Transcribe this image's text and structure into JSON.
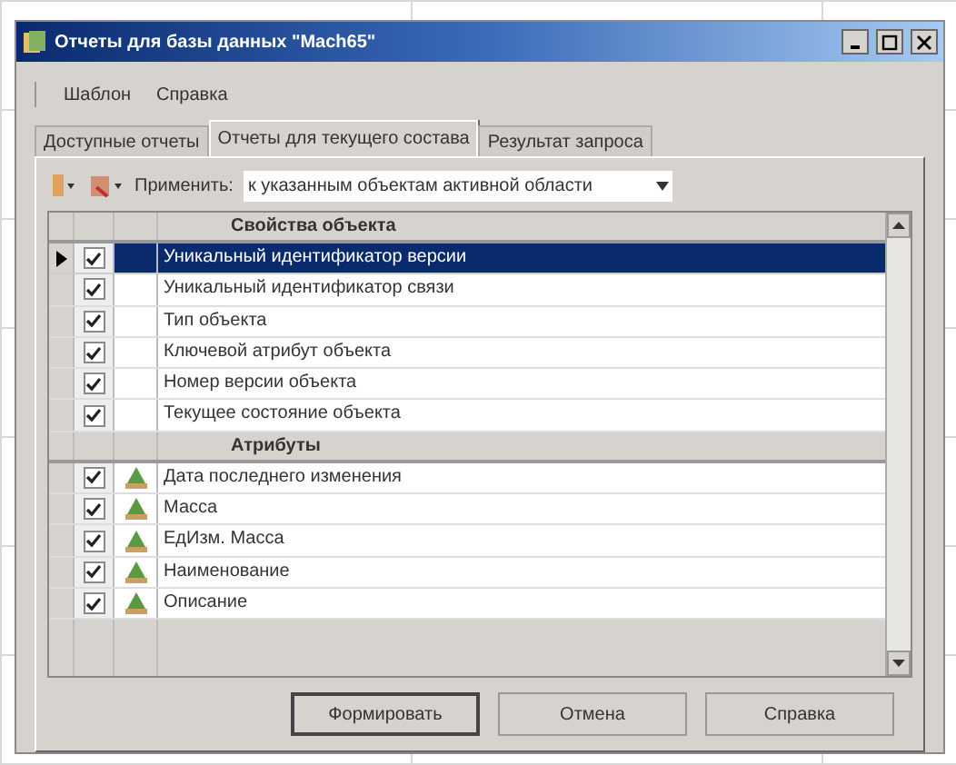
{
  "window": {
    "title": "Отчеты для базы данных \"Mach65\""
  },
  "menu": [
    "Шаблон",
    "Справка"
  ],
  "tabs": [
    {
      "label": "Доступные отчеты",
      "selected": false
    },
    {
      "label": "Отчеты для текущего состава",
      "selected": true
    },
    {
      "label": "Результат запроса",
      "selected": false
    }
  ],
  "toolbar": {
    "apply_label": "Применить:",
    "apply_value": "к указанным объектам активной области"
  },
  "groups": [
    {
      "title": "Свойства объекта",
      "rows": [
        {
          "label": "Уникальный идентификатор версии",
          "checked": true,
          "selected": true,
          "kind": "property"
        },
        {
          "label": "Уникальный идентификатор связи",
          "checked": true,
          "selected": false,
          "kind": "property"
        },
        {
          "label": "Тип объекта",
          "checked": true,
          "selected": false,
          "kind": "property"
        },
        {
          "label": "Ключевой атрибут объекта",
          "checked": true,
          "selected": false,
          "kind": "property"
        },
        {
          "label": "Номер версии объекта",
          "checked": true,
          "selected": false,
          "kind": "property"
        },
        {
          "label": "Текущее состояние объекта",
          "checked": true,
          "selected": false,
          "kind": "property"
        }
      ]
    },
    {
      "title": "Атрибуты",
      "rows": [
        {
          "label": "Дата последнего изменения",
          "checked": true,
          "selected": false,
          "kind": "attribute"
        },
        {
          "label": "Масса",
          "checked": true,
          "selected": false,
          "kind": "attribute"
        },
        {
          "label": "ЕдИзм. Масса",
          "checked": true,
          "selected": false,
          "kind": "attribute"
        },
        {
          "label": "Наименование",
          "checked": true,
          "selected": false,
          "kind": "attribute"
        },
        {
          "label": "Описание",
          "checked": true,
          "selected": false,
          "kind": "attribute"
        }
      ]
    }
  ],
  "buttons": [
    {
      "label": "Формировать",
      "default": true
    },
    {
      "label": "Отмена",
      "default": false
    },
    {
      "label": "Справка",
      "default": false
    }
  ]
}
